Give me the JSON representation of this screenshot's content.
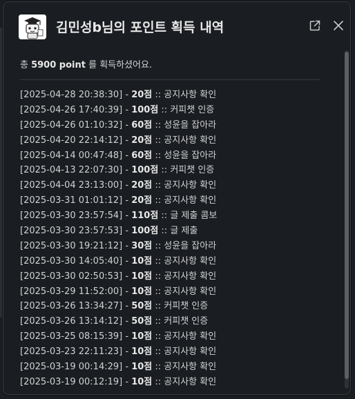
{
  "title": "김민성b님의 포인트 획득 내역",
  "summary": {
    "prefix": "총 ",
    "amount": "5900 point",
    "suffix": " 를 획득하셨어요."
  },
  "icons": {
    "app": "robot-mascot-icon",
    "external": "external-link-icon",
    "close": "close-icon"
  },
  "entries": [
    {
      "timestamp": "[2025-04-28 20:38:30]",
      "points": "20점",
      "reason": "공지사항 확인"
    },
    {
      "timestamp": "[2025-04-26 17:40:39]",
      "points": "100점",
      "reason": "커피챗 인증"
    },
    {
      "timestamp": "[2025-04-26 01:10:32]",
      "points": "60점",
      "reason": "성윤을 잡아라"
    },
    {
      "timestamp": "[2025-04-20 22:14:12]",
      "points": "20점",
      "reason": "공지사항 확인"
    },
    {
      "timestamp": "[2025-04-14 00:47:48]",
      "points": "60점",
      "reason": "성윤을 잡아라"
    },
    {
      "timestamp": "[2025-04-13 22:07:30]",
      "points": "100점",
      "reason": "커피챗 인증"
    },
    {
      "timestamp": "[2025-04-04 23:13:00]",
      "points": "20점",
      "reason": "공지사항 확인"
    },
    {
      "timestamp": "[2025-03-31 01:01:12]",
      "points": "20점",
      "reason": "공지사항 확인"
    },
    {
      "timestamp": "[2025-03-30 23:57:54]",
      "points": "110점",
      "reason": "글 제출 콤보"
    },
    {
      "timestamp": "[2025-03-30 23:57:53]",
      "points": "100점",
      "reason": "글 제출"
    },
    {
      "timestamp": "[2025-03-30 19:21:12]",
      "points": "30점",
      "reason": "성윤을 잡아라"
    },
    {
      "timestamp": "[2025-03-30 14:05:40]",
      "points": "10점",
      "reason": "공지사항 확인"
    },
    {
      "timestamp": "[2025-03-30 02:50:53]",
      "points": "10점",
      "reason": "공지사항 확인"
    },
    {
      "timestamp": "[2025-03-29 11:52:00]",
      "points": "10점",
      "reason": "공지사항 확인"
    },
    {
      "timestamp": "[2025-03-26 13:34:27]",
      "points": "50점",
      "reason": "커피챗 인증"
    },
    {
      "timestamp": "[2025-03-26 13:14:12]",
      "points": "50점",
      "reason": "커피챗 인증"
    },
    {
      "timestamp": "[2025-03-25 08:15:39]",
      "points": "10점",
      "reason": "공지사항 확인"
    },
    {
      "timestamp": "[2025-03-23 22:11:23]",
      "points": "10점",
      "reason": "공지사항 확인"
    },
    {
      "timestamp": "[2025-03-19 00:14:29]",
      "points": "10점",
      "reason": "공지사항 확인"
    },
    {
      "timestamp": "[2025-03-19 00:12:19]",
      "points": "10점",
      "reason": "공지사항 확인"
    }
  ],
  "colors": {
    "background": "#1a1d21",
    "text": "#d1d2d3",
    "title": "#e8e8e8",
    "border": "#3b3e43"
  }
}
